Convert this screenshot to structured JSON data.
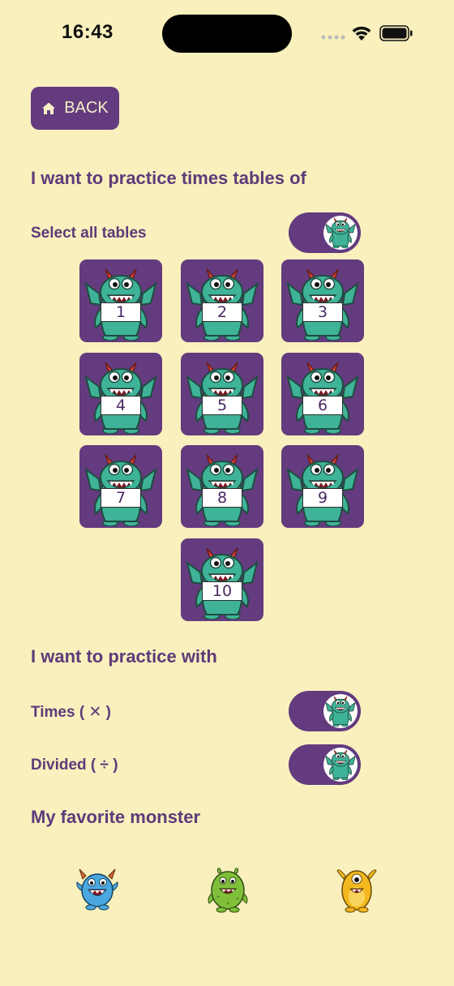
{
  "status": {
    "time": "16:43"
  },
  "back_button": {
    "label": "BACK",
    "icon": "home-icon"
  },
  "times_tables": {
    "title": "I want to practice times tables of",
    "select_all_label": "Select all tables",
    "select_all_on": true,
    "tables": [
      "1",
      "2",
      "3",
      "4",
      "5",
      "6",
      "7",
      "8",
      "9",
      "10"
    ]
  },
  "operations": {
    "title": "I want to practice with",
    "items": [
      {
        "label": "Times ( ✕ )",
        "on": true
      },
      {
        "label": "Divided ( ÷ )",
        "on": true
      }
    ]
  },
  "favorite": {
    "title": "My favorite monster",
    "monsters": [
      "blue-monster-icon",
      "green-monster-icon",
      "yellow-monster-icon"
    ]
  },
  "colors": {
    "background": "#F9F0BD",
    "accent": "#633B7E",
    "text": "#5F3A7A",
    "monster_teal": "#3FB397"
  }
}
